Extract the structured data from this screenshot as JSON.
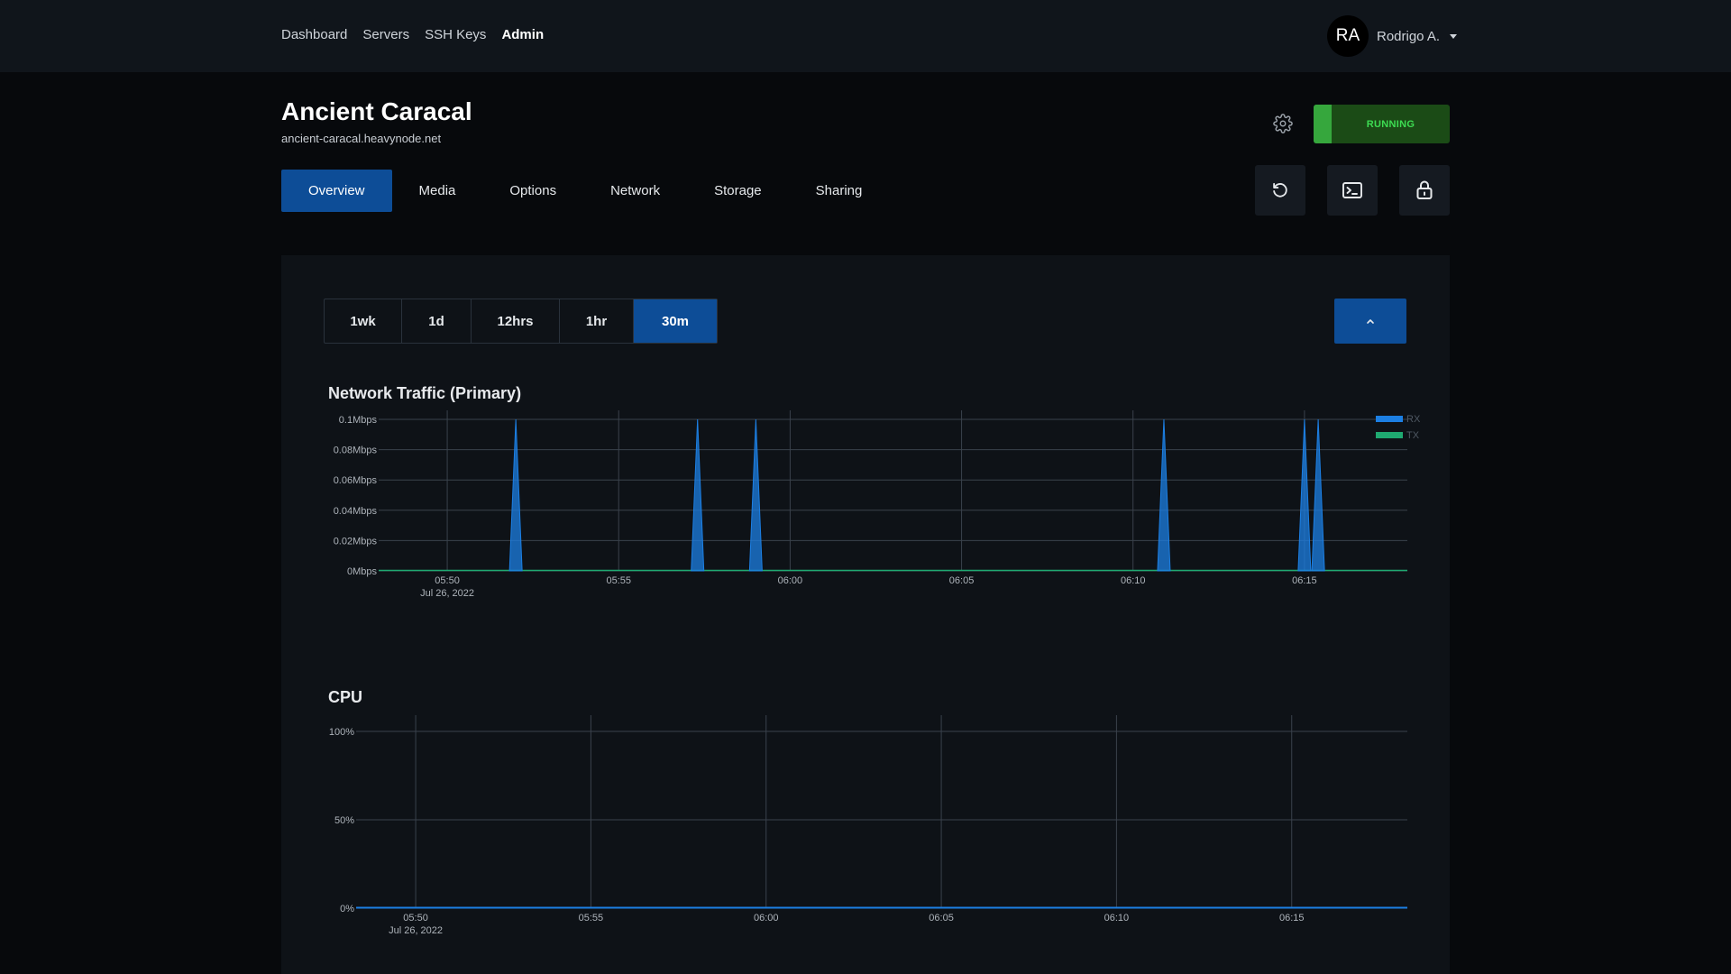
{
  "nav": {
    "links": [
      "Dashboard",
      "Servers",
      "SSH Keys",
      "Admin"
    ],
    "user": {
      "initials": "RA",
      "name": "Rodrigo A."
    }
  },
  "server": {
    "name": "Ancient Caracal",
    "hostname": "ancient-caracal.heavynode.net",
    "status": "RUNNING",
    "status_color": "#36a73d"
  },
  "tabs": [
    "Overview",
    "Media",
    "Options",
    "Network",
    "Storage",
    "Sharing"
  ],
  "active_tab": "Overview",
  "actions": [
    "restart-icon",
    "console-icon",
    "lock-icon"
  ],
  "time_ranges": [
    "1wk",
    "1d",
    "12hrs",
    "1hr",
    "30m"
  ],
  "active_range": "30m",
  "colors": {
    "accent": "#0d4d97",
    "rx": "#1c7fe3",
    "tx": "#1fa971",
    "status_bg": "#1b4b16"
  },
  "chart_data": [
    {
      "type": "area",
      "title": "Network Traffic (Primary)",
      "x_date_label": "Jul 26, 2022",
      "x_ticks": [
        "05:50",
        "05:55",
        "06:00",
        "06:05",
        "06:10",
        "06:15"
      ],
      "y_ticks": [
        "0Mbps",
        "0.02Mbps",
        "0.04Mbps",
        "0.06Mbps",
        "0.08Mbps",
        "0.1Mbps"
      ],
      "ylim": [
        0,
        0.1
      ],
      "xlim_minutes": [
        "05:48",
        "06:18"
      ],
      "legend_position": "top-right",
      "series": [
        {
          "name": "RX",
          "color": "#1c7fe3",
          "spikes": [
            {
              "time": "05:52",
              "value": 0.1
            },
            {
              "time": "05:57.3",
              "value": 0.1
            },
            {
              "time": "05:59",
              "value": 0.1
            },
            {
              "time": "06:10.9",
              "value": 0.1
            },
            {
              "time": "06:15",
              "value": 0.1
            },
            {
              "time": "06:15.4",
              "value": 0.1
            }
          ]
        },
        {
          "name": "TX",
          "color": "#1fa971",
          "spikes": []
        }
      ]
    },
    {
      "type": "line",
      "title": "CPU",
      "x_date_label": "Jul 26, 2022",
      "x_ticks": [
        "05:50",
        "05:55",
        "06:00",
        "06:05",
        "06:10",
        "06:15"
      ],
      "y_ticks": [
        "0%",
        "50%",
        "100%"
      ],
      "ylim": [
        0,
        100
      ],
      "series": [
        {
          "color": "#1c7fe3",
          "values": [
            0,
            0,
            0,
            0,
            0,
            0,
            0
          ]
        }
      ]
    }
  ]
}
